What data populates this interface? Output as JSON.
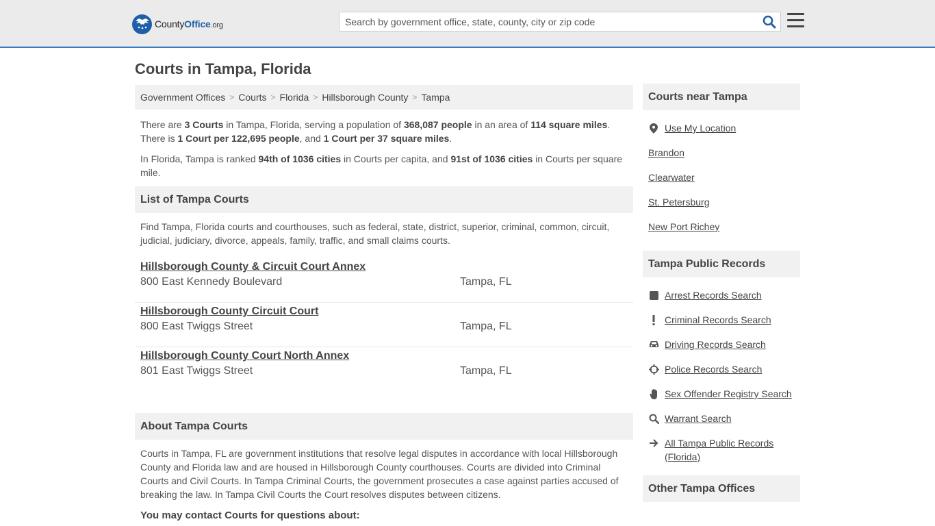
{
  "header": {
    "logo": {
      "county": "County",
      "office": "Office",
      "org": ".org"
    },
    "search_placeholder": "Search by government office, state, county, city or zip code"
  },
  "page_title": "Courts in Tampa, Florida",
  "breadcrumb": [
    "Government Offices",
    "Courts",
    "Florida",
    "Hillsborough County",
    "Tampa"
  ],
  "intro": {
    "p1": {
      "t1": "There are ",
      "b1": "3 Courts",
      "t2": " in Tampa, Florida, serving a population of ",
      "b2": "368,087 people",
      "t3": " in an area of ",
      "b3": "114 square miles",
      "t4": ". There is ",
      "b4": "1 Court per 122,695 people",
      "t5": ", and ",
      "b5": "1 Court per 37 square miles",
      "t6": "."
    },
    "p2": {
      "t1": "In Florida, Tampa is ranked ",
      "b1": "94th of 1036 cities",
      "t2": " in Courts per capita, and ",
      "b2": "91st of 1036 cities",
      "t3": " in Courts per square mile."
    }
  },
  "list_section": {
    "heading": "List of Tampa Courts",
    "description": "Find Tampa, Florida courts and courthouses, such as federal, state, district, superior, criminal, common, circuit, judicial, judiciary, divorce, appeals, family, traffic, and small claims courts.",
    "courts": [
      {
        "name": "Hillsborough County & Circuit Court Annex",
        "address": "800 East Kennedy Boulevard",
        "city": "Tampa, FL"
      },
      {
        "name": "Hillsborough County Circuit Court",
        "address": "800 East Twiggs Street",
        "city": "Tampa, FL"
      },
      {
        "name": "Hillsborough County Court North Annex",
        "address": "801 East Twiggs Street",
        "city": "Tampa, FL"
      }
    ]
  },
  "about_section": {
    "heading": "About Tampa Courts",
    "description": "Courts in Tampa, FL are government institutions that resolve legal disputes in accordance with local Hillsborough County and Florida law and are housed in Hillsborough County courthouses. Courts are divided into Criminal Courts and Civil Courts. In Tampa Criminal Courts, the government prosecutes a case against parties accused of breaking the law. In Tampa Civil Courts the Court resolves disputes between citizens.",
    "contact_heading": "You may contact Courts for questions about:"
  },
  "sidebar": {
    "nearby": {
      "heading": "Courts near Tampa",
      "items": [
        {
          "label": "Use My Location",
          "icon": "location-pin-icon"
        },
        {
          "label": "Brandon"
        },
        {
          "label": "Clearwater"
        },
        {
          "label": "St. Petersburg"
        },
        {
          "label": "New Port Richey"
        }
      ]
    },
    "records": {
      "heading": "Tampa Public Records",
      "items": [
        {
          "label": "Arrest Records Search",
          "icon": "square-icon"
        },
        {
          "label": "Criminal Records Search",
          "icon": "exclamation-icon"
        },
        {
          "label": "Driving Records Search",
          "icon": "car-icon"
        },
        {
          "label": "Police Records Search",
          "icon": "crosshair-icon"
        },
        {
          "label": "Sex Offender Registry Search",
          "icon": "hand-icon"
        },
        {
          "label": "Warrant Search",
          "icon": "magnifier-icon"
        },
        {
          "label": "All Tampa Public Records (Florida)",
          "icon": "arrow-right-icon"
        }
      ]
    },
    "other": {
      "heading": "Other Tampa Offices"
    }
  }
}
